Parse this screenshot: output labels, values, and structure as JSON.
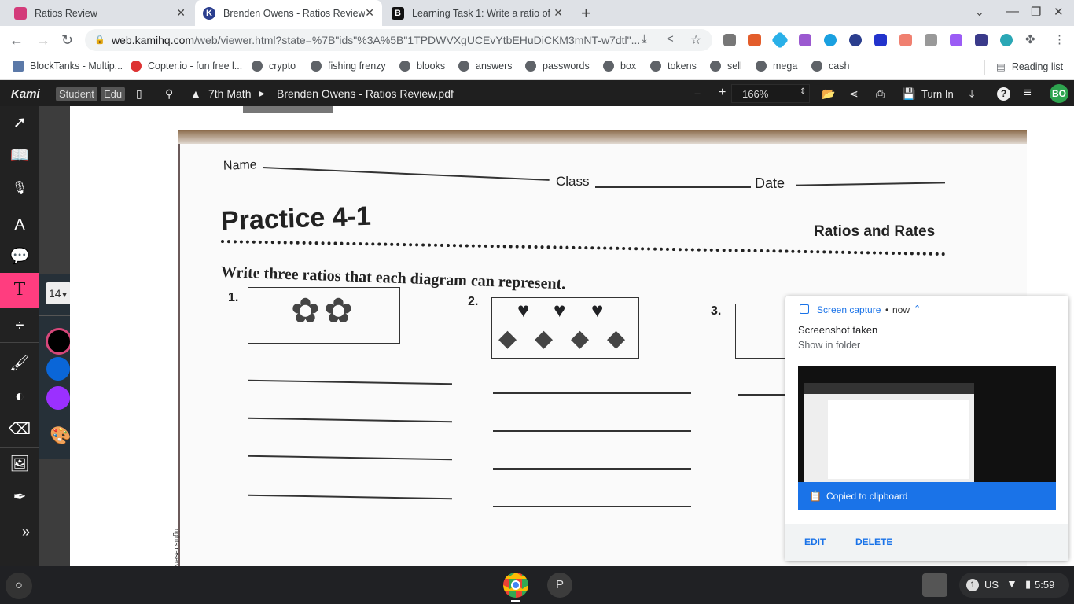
{
  "tabs": [
    {
      "label": "Ratios Review",
      "color": "#d33b7a",
      "glyph": ""
    },
    {
      "label": "Brenden Owens - Ratios Review.p",
      "color": "#2b3e8e",
      "glyph": "K"
    },
    {
      "label": "Learning Task 1: Write a ratio of",
      "color": "#111",
      "glyph": "B"
    }
  ],
  "url": {
    "host": "web.kamihq.com",
    "path": "/web/viewer.html?state=%7B\"ids\"%3A%5B\"1TPDWVXgUCEvYtbEHuDiCKM3mNT-w7dtl\"..."
  },
  "bookmarks": [
    "BlockTanks - Multip...",
    "Copter.io - fun free l...",
    "crypto",
    "fishing frenzy",
    "blooks",
    "answers",
    "passwords",
    "box",
    "tokens",
    "sell",
    "mega",
    "cash"
  ],
  "reading_list": "Reading list",
  "kami": {
    "logo": "Kami",
    "student": "Student",
    "edu": "Edu",
    "folder": "7th Math",
    "file": "Brenden Owens - Ratios Review.pdf",
    "zoom": "166%",
    "turn_in": "Turn In",
    "avatar": "BO",
    "font_size": "14",
    "colors": [
      "#000000",
      "#0a66d8",
      "#9b30ff"
    ]
  },
  "doc": {
    "name": "Name",
    "class": "Class",
    "date": "Date",
    "title": "Practice 4-1",
    "subtitle": "Ratios and Rates",
    "instructions": "Write three ratios that each diagram can represent.",
    "q": [
      "1.",
      "2.",
      "3."
    ],
    "side": "rights reserved."
  },
  "notification": {
    "source": "Screen capture",
    "time": "now",
    "title": "Screenshot taken",
    "link": "Show in folder",
    "copied": "Copied to clipboard",
    "edit": "EDIT",
    "delete": "DELETE"
  },
  "taskbar": {
    "p": "P",
    "badge": "1",
    "lang": "US",
    "time": "5:59"
  }
}
